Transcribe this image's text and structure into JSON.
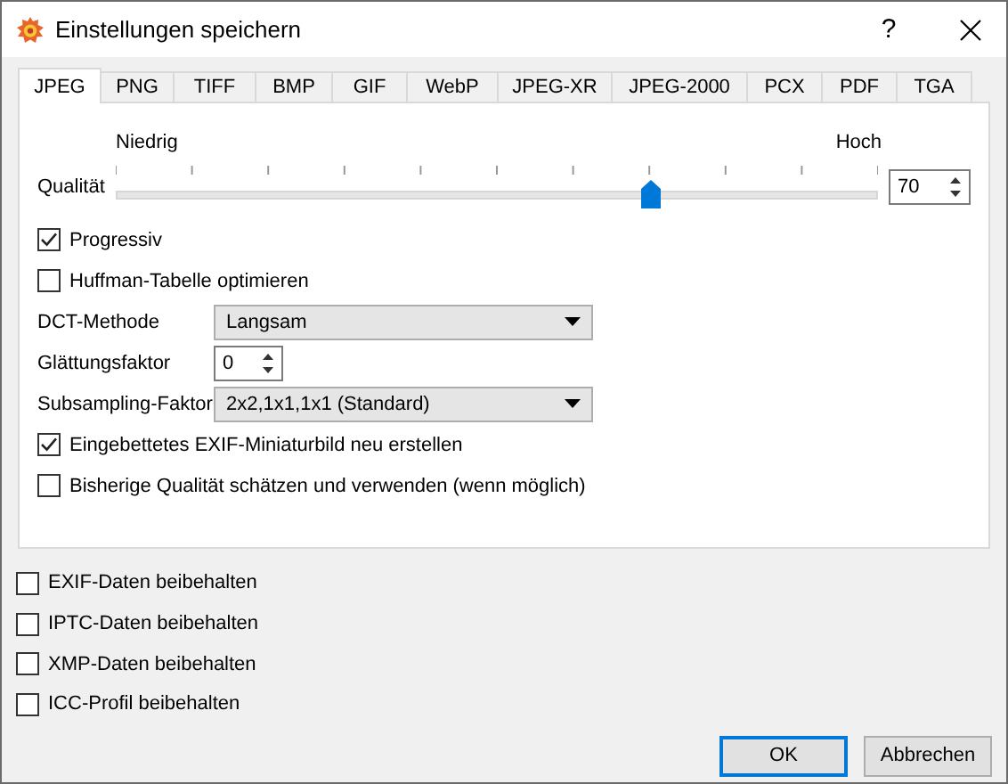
{
  "window": {
    "title": "Einstellungen speichern",
    "help": "?"
  },
  "tabs": [
    {
      "label": "JPEG",
      "selected": true
    },
    {
      "label": "PNG",
      "selected": false
    },
    {
      "label": "TIFF",
      "selected": false
    },
    {
      "label": "BMP",
      "selected": false
    },
    {
      "label": "GIF",
      "selected": false
    },
    {
      "label": "WebP",
      "selected": false
    },
    {
      "label": "JPEG-XR",
      "selected": false
    },
    {
      "label": "JPEG-2000",
      "selected": false
    },
    {
      "label": "PCX",
      "selected": false
    },
    {
      "label": "PDF",
      "selected": false
    },
    {
      "label": "TGA",
      "selected": false
    }
  ],
  "quality": {
    "label": "Qualität",
    "low_label": "Niedrig",
    "high_label": "Hoch",
    "level": 0.7,
    "value": "70"
  },
  "options": [
    {
      "kind": "checkbox",
      "label": "Progressiv",
      "checked": true
    },
    {
      "kind": "checkbox",
      "label": "Huffman-Tabelle optimieren",
      "checked": false
    },
    {
      "kind": "select",
      "label": "DCT-Methode",
      "value": "Langsam"
    },
    {
      "kind": "spin",
      "label": "Glättungsfaktor",
      "value": "0"
    },
    {
      "kind": "select",
      "label": "Subsampling-Faktor",
      "value": "2x2,1x1,1x1 (Standard)"
    },
    {
      "kind": "checkbox",
      "label": "Eingebettetes EXIF-Miniaturbild neu erstellen",
      "checked": true
    },
    {
      "kind": "checkbox",
      "label": "Bisherige Qualität schätzen und verwenden (wenn möglich)",
      "checked": false
    }
  ],
  "metadata": [
    {
      "label": "EXIF-Daten beibehalten",
      "checked": false
    },
    {
      "label": "IPTC-Daten beibehalten",
      "checked": false
    },
    {
      "label": "XMP-Daten beibehalten",
      "checked": false
    },
    {
      "label": "ICC-Profil beibehalten",
      "checked": false
    }
  ],
  "buttons": [
    {
      "label": "OK",
      "default": true
    },
    {
      "label": "Abbrechen",
      "default": false
    }
  ]
}
